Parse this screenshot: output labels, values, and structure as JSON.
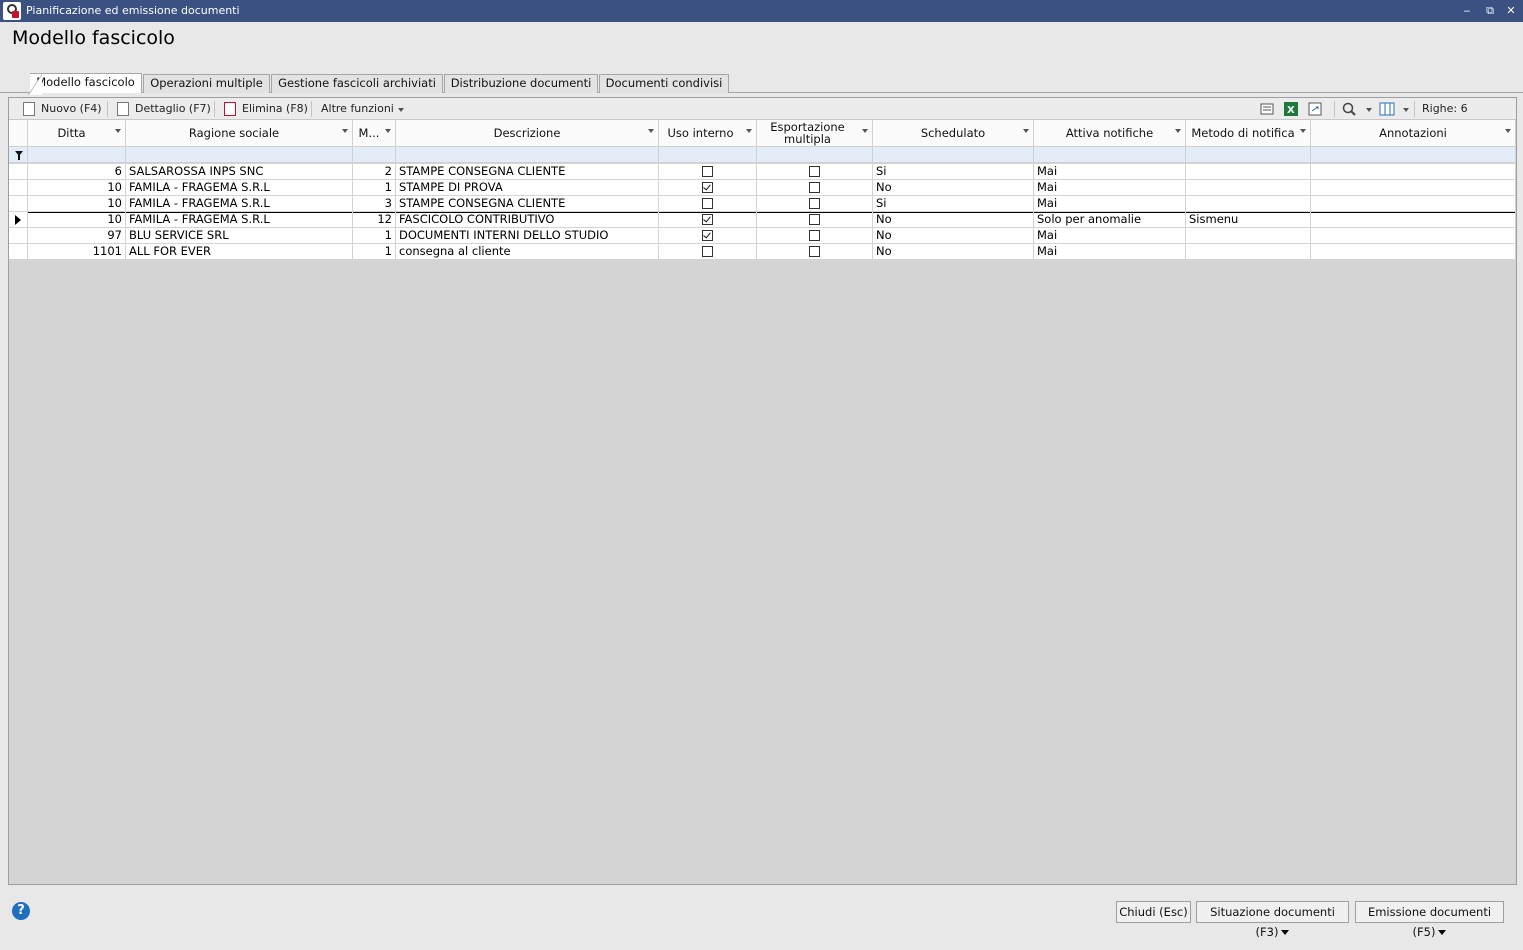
{
  "window": {
    "title": "Pianificazione ed emissione documenti",
    "min_glyph": "‒",
    "restore_glyph": "⧉",
    "close_glyph": "✕"
  },
  "page_title": "Modello fascicolo",
  "tabs": [
    {
      "label": "Modello fascicolo",
      "active": true
    },
    {
      "label": "Operazioni multiple"
    },
    {
      "label": "Gestione fascicoli archiviati"
    },
    {
      "label": "Distribuzione documenti"
    },
    {
      "label": "Documenti condivisi"
    }
  ],
  "toolbar": {
    "nuovo": "Nuovo (F4)",
    "dettaglio": "Dettaglio (F7)",
    "elimina": "Elimina (F8)",
    "altre": "Altre funzioni",
    "rows_label": "Righe: 6",
    "icons": [
      "print-preview-icon",
      "excel-export-icon",
      "refresh-layout-icon",
      "search-icon",
      "column-chooser-icon"
    ]
  },
  "grid": {
    "columns": [
      "Ditta",
      "Ragione sociale",
      "M...",
      "Descrizione",
      "Uso interno",
      "Esportazione multipla",
      "Schedulato",
      "Attiva notifiche",
      "Metodo di notifica",
      "Annotazioni"
    ],
    "rows": [
      {
        "ditta": "6",
        "ragione": "SALSAROSSA INPS SNC",
        "m": "2",
        "descrizione": "STAMPE CONSEGNA CLIENTE",
        "uso_interno": false,
        "esportazione": false,
        "schedulato": "Si",
        "notifiche": "Mai",
        "metodo": "",
        "annotazioni": ""
      },
      {
        "ditta": "10",
        "ragione": "FAMILA - FRAGEMA S.R.L",
        "m": "1",
        "descrizione": "STAMPE DI PROVA",
        "uso_interno": true,
        "esportazione": false,
        "schedulato": "No",
        "notifiche": "Mai",
        "metodo": "",
        "annotazioni": ""
      },
      {
        "ditta": "10",
        "ragione": "FAMILA - FRAGEMA S.R.L",
        "m": "3",
        "descrizione": "STAMPE CONSEGNA CLIENTE",
        "uso_interno": false,
        "esportazione": false,
        "schedulato": "Si",
        "notifiche": "Mai",
        "metodo": "",
        "annotazioni": ""
      },
      {
        "ditta": "10",
        "ragione": "FAMILA - FRAGEMA S.R.L",
        "m": "12",
        "descrizione": "FASCICOLO CONTRIBUTIVO",
        "uso_interno": true,
        "esportazione": false,
        "schedulato": "No",
        "notifiche": "Solo per anomalie",
        "metodo": "Sismenu",
        "annotazioni": "",
        "current": true
      },
      {
        "ditta": "97",
        "ragione": "BLU SERVICE SRL",
        "m": "1",
        "descrizione": "DOCUMENTI INTERNI DELLO STUDIO",
        "uso_interno": true,
        "esportazione": false,
        "schedulato": "No",
        "notifiche": "Mai",
        "metodo": "",
        "annotazioni": ""
      },
      {
        "ditta": "1101",
        "ragione": "ALL FOR EVER",
        "m": "1",
        "descrizione": "consegna al cliente",
        "uso_interno": false,
        "esportazione": false,
        "schedulato": "No",
        "notifiche": "Mai",
        "metodo": "",
        "annotazioni": ""
      }
    ]
  },
  "footer": {
    "help": "?",
    "chiudi": "Chiudi (Esc)",
    "situazione": "Situazione documenti (F3)",
    "emissione": "Emissione documenti (F5)"
  },
  "colors": {
    "titlebar": "#3b5182",
    "filter_row": "#e4ecf7",
    "help": "#1f6fbf"
  }
}
